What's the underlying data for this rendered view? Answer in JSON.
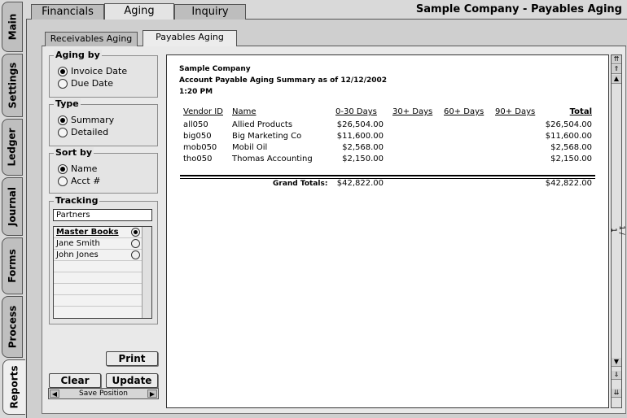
{
  "window": {
    "company_title": "Sample Company - Payables Aging"
  },
  "top_tabs": [
    "Financials",
    "Aging",
    "Inquiry"
  ],
  "side_tabs": [
    "Main",
    "Settings",
    "Ledger",
    "Journal",
    "Forms",
    "Process",
    "Reports"
  ],
  "sub_tabs": [
    "Receivables Aging",
    "Payables Aging"
  ],
  "aging_by": {
    "title": "Aging by",
    "options": [
      "Invoice Date",
      "Due Date"
    ],
    "selected": 0
  },
  "type": {
    "title": "Type",
    "options": [
      "Summary",
      "Detailed"
    ],
    "selected": 0
  },
  "sort_by": {
    "title": "Sort by",
    "options": [
      "Name",
      "Acct #"
    ],
    "selected": 0
  },
  "tracking": {
    "title": "Tracking",
    "field_value": "Partners",
    "items": [
      "Master Books",
      "Jane Smith",
      "John Jones"
    ],
    "selected": 0
  },
  "buttons": {
    "print": "Print",
    "clear": "Clear",
    "update": "Update",
    "save_position": "Save Position"
  },
  "report": {
    "company": "Sample Company",
    "title": "Account Payable Aging Summary as of 12/12/2002",
    "time": "1:20 PM",
    "headers": [
      "Vendor ID",
      "Name",
      "0-30 Days",
      "30+ Days",
      "60+ Days",
      "90+ Days",
      "Total"
    ],
    "rows": [
      {
        "id": "all050",
        "name": "Allied Products",
        "d0": "$26,504.00",
        "total": "$26,504.00"
      },
      {
        "id": "big050",
        "name": "Big Marketing Co",
        "d0": "$11,600.00",
        "total": "$11,600.00"
      },
      {
        "id": "mob050",
        "name": "Mobil Oil",
        "d0": "$2,568.00",
        "total": "$2,568.00"
      },
      {
        "id": "tho050",
        "name": "Thomas Accounting",
        "d0": "$2,150.00",
        "total": "$2,150.00"
      }
    ],
    "grand_label": "Grand Totals:",
    "grand_d0": "$42,822.00",
    "grand_total": "$42,822.00",
    "page_indicator": "1 / 1"
  }
}
